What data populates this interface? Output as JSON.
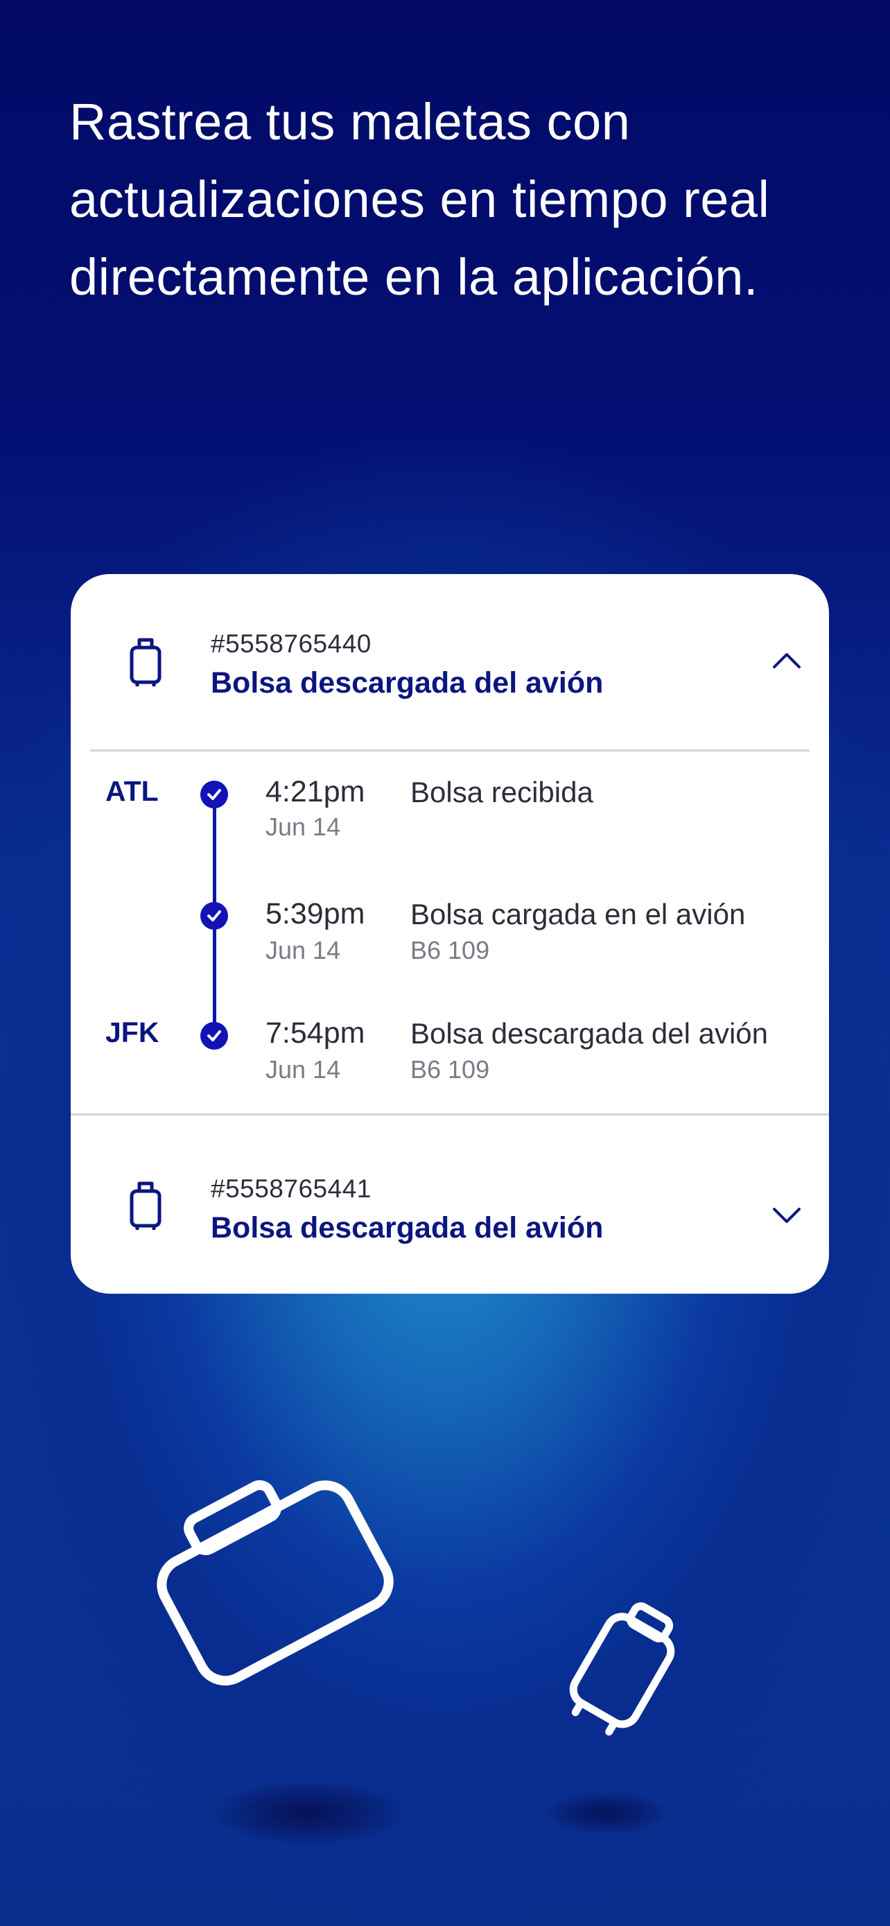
{
  "headline": {
    "line1": "Rastrea tus maletas con",
    "line2": "actualizaciones en tiempo real",
    "line3": "directamente en la aplicación."
  },
  "bags": [
    {
      "id": "#5558765440",
      "status": "Bolsa descargada del avión",
      "expanded": true,
      "icon": "luggage-icon",
      "toggle_icon": "chevron-up-icon"
    },
    {
      "id": "#5558765441",
      "status": "Bolsa descargada del avión",
      "expanded": false,
      "icon": "luggage-icon",
      "toggle_icon": "chevron-down-icon"
    }
  ],
  "timeline": [
    {
      "airport": "ATL",
      "time": "4:21pm",
      "date": "Jun 14",
      "description": "Bolsa recibida",
      "flight": ""
    },
    {
      "airport": "",
      "time": "5:39pm",
      "date": "Jun 14",
      "description": "Bolsa cargada en el avión",
      "flight": "B6 109"
    },
    {
      "airport": "JFK",
      "time": "7:54pm",
      "date": "Jun 14",
      "description": "Bolsa descargada del avión",
      "flight": "B6 109"
    }
  ],
  "colors": {
    "brand_navy": "#0b1680",
    "timeline_blue": "#1212b5",
    "background_top": "#020a66",
    "background_glow": "#1f8ecb"
  }
}
